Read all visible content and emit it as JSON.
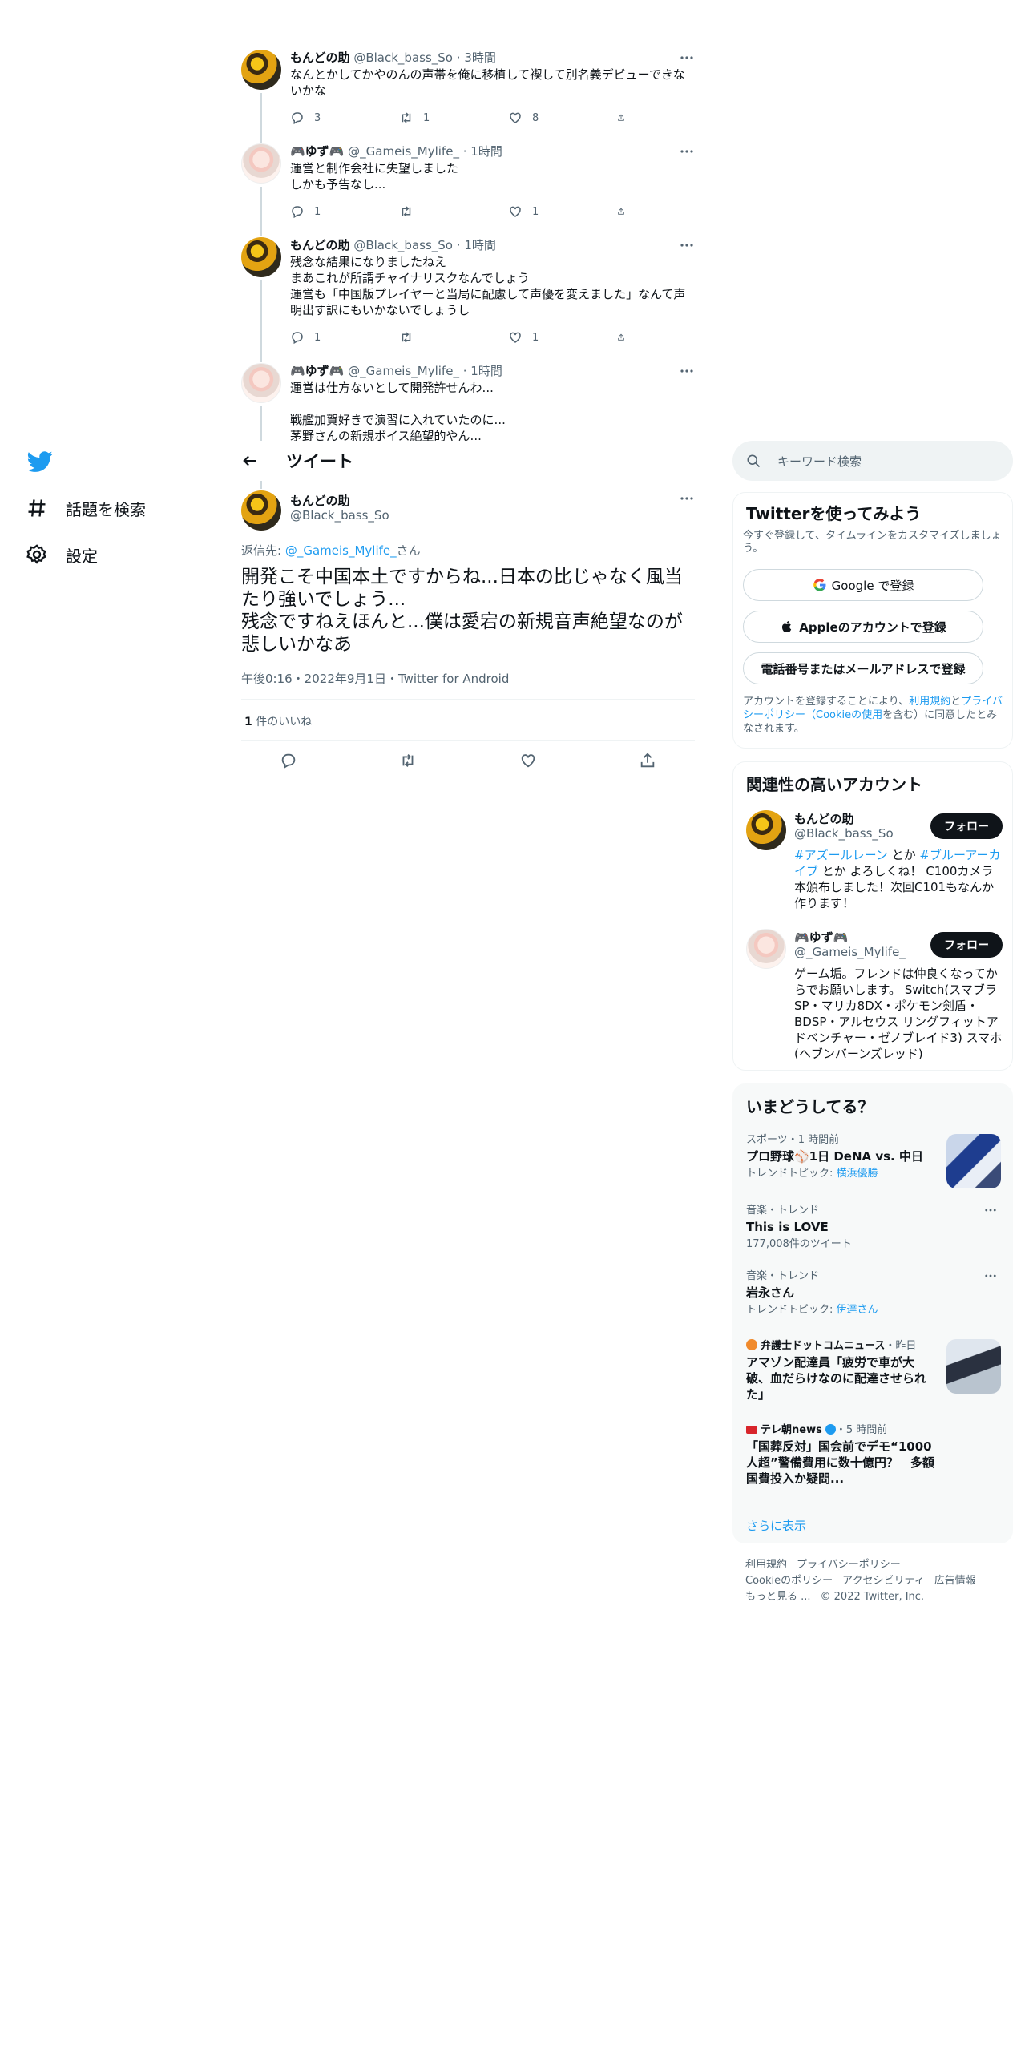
{
  "nav": {
    "explore_label": "話題を検索",
    "settings_label": "設定"
  },
  "thread": [
    {
      "name": "もんどの助",
      "handle": "@Black_bass_So",
      "time": "3時間",
      "text": "なんとかしてかやのんの声帯を俺に移植して禊して別名義デビューできないかな",
      "replies": "3",
      "retweets": "1",
      "likes": "8"
    },
    {
      "name": "🎮ゆず🎮",
      "handle": "@_Gameis_Mylife_",
      "time": "1時間",
      "text": "運営と制作会社に失望しました\nしかも予告なし...",
      "replies": "1",
      "retweets": "",
      "likes": "1"
    },
    {
      "name": "もんどの助",
      "handle": "@Black_bass_So",
      "time": "1時間",
      "text": "残念な結果になりましたねえ\nまあこれが所謂チャイナリスクなんでしょう\n運営も「中国版プレイヤーと当局に配慮して声優を変えました」なんて声明出す訳にもいかないでしょうし",
      "replies": "1",
      "retweets": "",
      "likes": "1"
    },
    {
      "name": "🎮ゆず🎮",
      "handle": "@_Gameis_Mylife_",
      "time": "1時間",
      "text": "運営は仕方ないとして開発許せんわ...\n\n戦艦加賀好きで演習に入れていたのに...\n茅野さんの新規ボイス絶望的やん..."
    }
  ],
  "header": {
    "title": "ツイート"
  },
  "focus": {
    "name": "もんどの助",
    "handle": "@Black_bass_So",
    "reply_prefix": "返信先: ",
    "reply_handle": "@_Gameis_Mylife_",
    "reply_suffix": "さん",
    "text": "開発こそ中国本土ですからね...日本の比じゃなく風当たり強いでしょう...\n残念ですねえほんと...僕は愛宕の新規音声絶望なのが悲しいかなあ",
    "meta": "午後0:16・2022年9月1日・Twitter for Android",
    "like_count": "1",
    "like_label": " 件のいいね"
  },
  "search": {
    "placeholder": "キーワード検索"
  },
  "signup": {
    "title": "Twitterを使ってみよう",
    "desc": "今すぐ登録して、タイムラインをカスタマイズしましょう。",
    "google_label": "Google で登録",
    "apple_label": "Appleのアカウントで登録",
    "phone_label": "電話番号またはメールアドレスで登録",
    "terms_1": "アカウントを登録することにより、",
    "terms_link_1": "利用規約",
    "terms_2": "と",
    "terms_link_2": "プライバシーポリシー（Cookieの使用",
    "terms_3": "を含む）に同意したとみなされます。"
  },
  "related": {
    "title": "関連性の高いアカウント",
    "follow_label": "フォロー",
    "accounts": [
      {
        "name": "もんどの助",
        "handle": "@Black_bass_So",
        "tag_1": "#アズールレーン",
        "mid": " とか ",
        "tag_2": "#ブルーアーカイブ",
        "bio_rest": " とか よろしくね！ C100カメラ本頒布しました！次回C101もなんか作ります！"
      },
      {
        "name": "🎮ゆず🎮",
        "handle": "@_Gameis_Mylife_",
        "bio": "ゲーム垢。フレンドは仲良くなってからでお願いします。 Switch(スマブラSP・マリカ8DX・ポケモン剣盾・BDSP・アルセウス リングフィットアドベンチャー・ゼノブレイド3) スマホ(ヘブンバーンズレッド)"
      }
    ]
  },
  "trends": {
    "title": "いまどうしてる？",
    "items": [
      {
        "meta": "スポーツ・1 時間前",
        "title": "プロ野球⚾1日 DeNA vs. 中日",
        "sub_prefix": "トレンドトピック: ",
        "sub_link": "横浜優勝"
      },
      {
        "meta": "音楽・トレンド",
        "title": "This is LOVE",
        "sub": "177,008件のツイート"
      },
      {
        "meta": "音楽・トレンド",
        "title": "岩永さん",
        "sub_prefix": "トレンドトピック: ",
        "sub_link": "伊達さん"
      },
      {
        "source": "弁護士ドットコムニュース",
        "meta": "・昨日",
        "title": "アマゾン配達員「疲労で車が大破、血だらけなのに配達させられた」"
      },
      {
        "source": "テレ朝news",
        "meta": "・5 時間前",
        "title": "「国葬反対」国会前でデモ“1000人超”警備費用に数十億円？　多額国費投入か疑問..."
      }
    ],
    "show_more": "さらに表示"
  },
  "footer": {
    "links": [
      "利用規約",
      "プライバシーポリシー",
      "Cookieのポリシー",
      "アクセシビリティ",
      "広告情報",
      "もっと見る ..."
    ],
    "copyright": "© 2022 Twitter, Inc."
  }
}
